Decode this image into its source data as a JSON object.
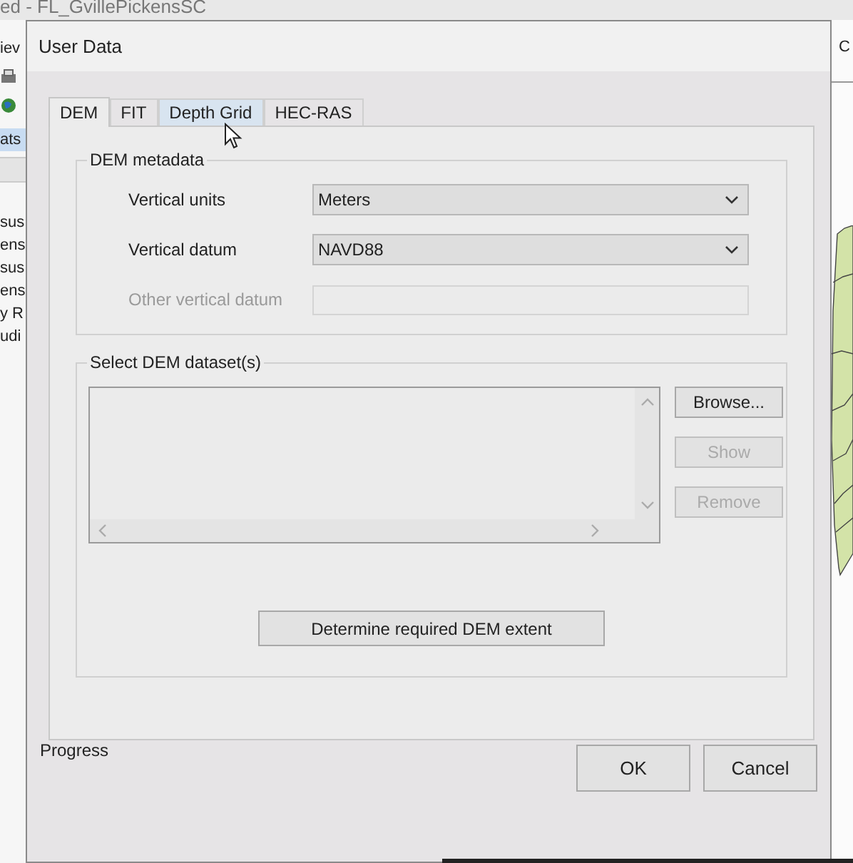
{
  "background_window": {
    "title": "ed - FL_GvillePickensSC",
    "menu_fragment": "iev",
    "header_fragment": "ats",
    "list_fragments": [
      "sus",
      "ens",
      "sus",
      "ens",
      "y R",
      "udi"
    ],
    "corner_fragment": "C"
  },
  "dialog": {
    "title": "User Data",
    "tabs": [
      {
        "label": "DEM",
        "selected": true,
        "hovered": false
      },
      {
        "label": "FIT",
        "selected": false,
        "hovered": false
      },
      {
        "label": "Depth Grid",
        "selected": false,
        "hovered": true
      },
      {
        "label": "HEC-RAS",
        "selected": false,
        "hovered": false
      }
    ],
    "metadata_group": {
      "title": "DEM metadata",
      "fields": [
        {
          "label": "Vertical units",
          "kind": "select",
          "value": "Meters",
          "disabled": false
        },
        {
          "label": "Vertical datum",
          "kind": "select",
          "value": "NAVD88",
          "disabled": false
        },
        {
          "label": "Other vertical datum",
          "kind": "text",
          "disabled": true
        }
      ]
    },
    "dataset_group": {
      "title": "Select DEM dataset(s)",
      "buttons": [
        {
          "label": "Browse...",
          "disabled": false
        },
        {
          "label": "Show",
          "disabled": true
        },
        {
          "label": "Remove",
          "disabled": true
        }
      ],
      "extent_button": "Determine required DEM extent"
    },
    "progress_label": "Progress",
    "buttons": [
      "OK",
      "Cancel"
    ]
  }
}
